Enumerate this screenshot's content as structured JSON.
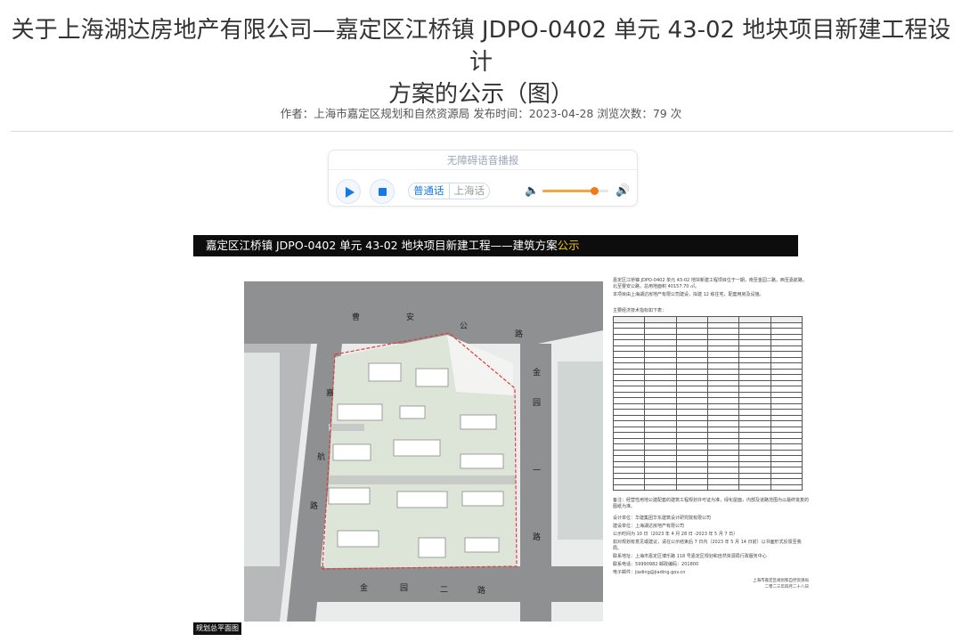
{
  "article": {
    "title_line1": "关于上海湖达房地产有限公司—嘉定区江桥镇 JDPO-0402 单元 43-02 地块项目新建工程设计",
    "title_line2": "方案的公示（图）",
    "meta": "作者：上海市嘉定区规划和自然资源局 发布时间：2023-04-28 浏览次数：79 次"
  },
  "player": {
    "header": "无障碍语音播报",
    "lang_on": "普通话",
    "lang_off": "上海话",
    "volume_level": 0.78,
    "accent_color": "#1677e6"
  },
  "document": {
    "bar_text": "嘉定区江桥镇 JDPO-0402 单元 43-02 地块项目新建工程——建筑方案",
    "bar_accent": "公示",
    "caption": "规划总平面图",
    "roads": {
      "north": [
        "曹",
        "安",
        "公",
        "路"
      ],
      "east": [
        "金",
        "园",
        "一",
        "路"
      ],
      "west": [
        "嘉",
        "航",
        "路"
      ],
      "south": [
        "金",
        "园",
        "二",
        "路"
      ]
    },
    "notes": {
      "intro": "嘉定区江桥镇 JDPO-0402 单元 43-02 地块新建工程项目位于一期，南至金园二路，西至嘉航路，北至曹安公路，总用地面积 40157.70 ㎡。",
      "intro2": "本项目由上海湖达房地产有限公司建设，拟建 12 栋住宅，配套用房及设施。",
      "table_title": "主要经济技术指标如下表：",
      "remark": "备注：经营性用地公建配套的建筑工程规划许可证为准，绿化屋面，内部及道路范围为以最终批复的图纸为准。",
      "contact": [
        "设计单位：华建集团华东建筑设计研究院有限公司",
        "建设单位：上海湖达房地产有限公司",
        "公示时间为 10 日（2023 年 4 月 28 日 -2023 年 5 月 7 日）",
        "如对规划有意见或建议，请在公示结束后 7 日内（2023 年 5 月 14 日前）以书面形式反馈至我局。",
        "联系地址：上海市嘉定区博乐路 118 号嘉定区规划和自然资源局行政服务中心",
        "联系电话：59990982  邮政编码：201800",
        "电子邮件：jiading@jiading.gov.cn"
      ],
      "sign1": "上海市嘉定区规划和自然资源局",
      "sign2": "二零二三年四月二十八日"
    }
  }
}
